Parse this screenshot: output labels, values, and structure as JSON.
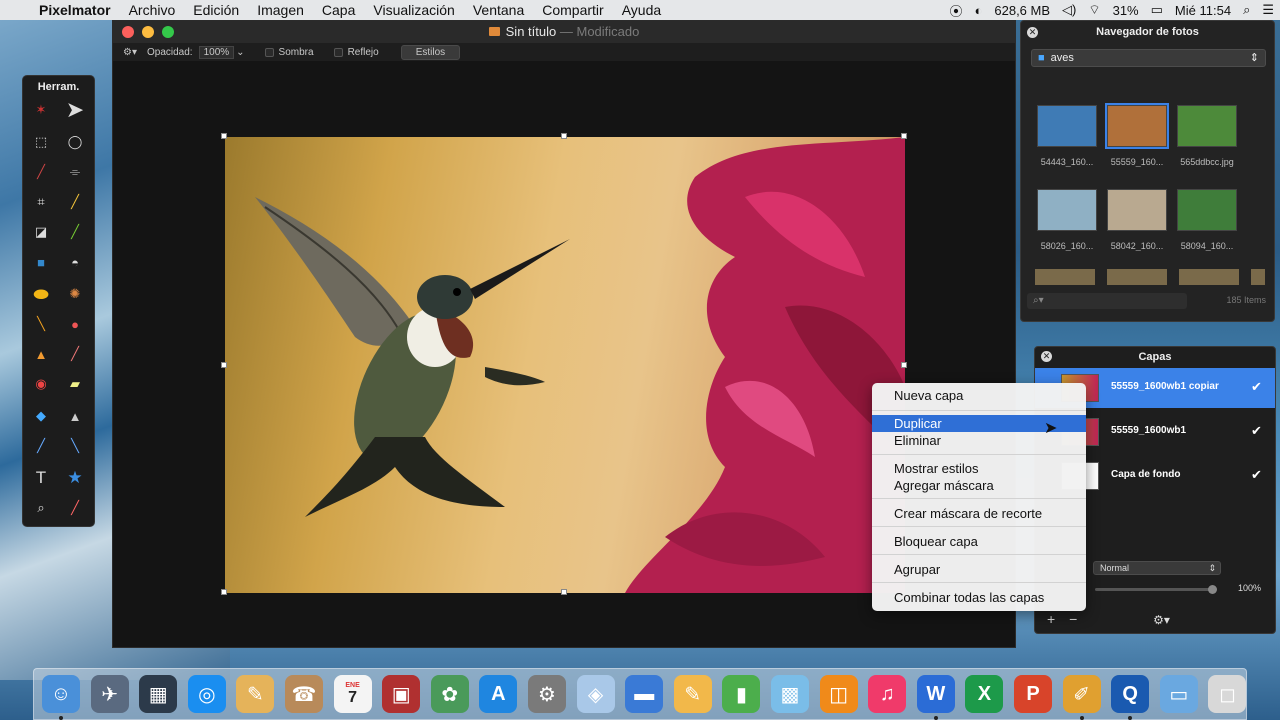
{
  "menubar": {
    "apple": "",
    "items": [
      "Pixelmator",
      "Archivo",
      "Edición",
      "Imagen",
      "Capa",
      "Visualización",
      "Ventana",
      "Compartir",
      "Ayuda"
    ],
    "memory": "628,6 MB",
    "battery": "31%",
    "clock": "Mié 11:54"
  },
  "window": {
    "title": "Sin título",
    "status": "Modificado"
  },
  "toolbar": {
    "opacity_label": "Opacidad:",
    "opacity_value": "100%",
    "shadow_label": "Sombra",
    "reflection_label": "Reflejo",
    "styles_label": "Estilos"
  },
  "tools": {
    "title": "Herram."
  },
  "browser": {
    "title": "Navegador de fotos",
    "folder": "aves",
    "thumbs": [
      {
        "label": "54443_160...",
        "color": "#3f7bb5"
      },
      {
        "label": "55559_160...",
        "color": "#b0703a"
      },
      {
        "label": "565ddbcc.jpg",
        "color": "#4d8a3a"
      },
      {
        "label": "58026_160...",
        "color": "#8fb0c4"
      },
      {
        "label": "58042_160...",
        "color": "#b9a990"
      },
      {
        "label": "58094_160...",
        "color": "#3f7d3a"
      }
    ],
    "count": "185 Items"
  },
  "layers": {
    "title": "Capas",
    "items": [
      {
        "name": "55559_1600wb1 copiar"
      },
      {
        "name": "55559_1600wb1"
      },
      {
        "name": "Capa de fondo"
      }
    ],
    "blend_mode": "Normal",
    "opacity": "100%"
  },
  "context_menu": {
    "new_layer": "Nueva capa",
    "duplicate": "Duplicar",
    "delete": "Eliminar",
    "show_styles": "Mostrar estilos",
    "add_mask": "Agregar máscara",
    "clipping_mask": "Crear máscara de recorte",
    "lock_layer": "Bloquear capa",
    "group": "Agrupar",
    "merge_all": "Combinar todas las capas"
  },
  "dock": {
    "apps": [
      "finder",
      "launchpad",
      "mission-control",
      "safari",
      "preview",
      "contacts",
      "calendar",
      "photo-booth",
      "iphoto",
      "app-store",
      "system-preferences",
      "3d-app",
      "keynote",
      "pages",
      "numbers",
      "preview-2",
      "ibooks",
      "itunes",
      "word",
      "excel",
      "powerpoint",
      "pixelmator",
      "quicktime",
      "folder",
      "trash"
    ],
    "calendar_day": "7",
    "calendar_month": "ENE"
  }
}
